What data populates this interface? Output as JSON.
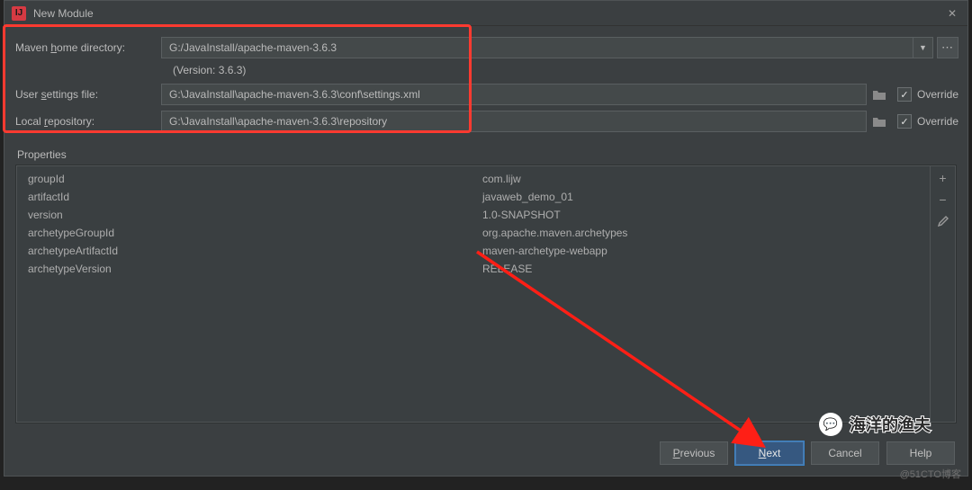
{
  "window": {
    "title": "New Module"
  },
  "form": {
    "mavenHome": {
      "label_pre": "Maven ",
      "label_u": "h",
      "label_post": "ome directory:",
      "value": "G:/JavaInstall/apache-maven-3.6.3"
    },
    "version": "(Version: 3.6.3)",
    "userSettings": {
      "label_pre": "User ",
      "label_u": "s",
      "label_post": "ettings file:",
      "value": "G:\\JavaInstall\\apache-maven-3.6.3\\conf\\settings.xml",
      "override": "Override"
    },
    "localRepo": {
      "label_pre": "Local ",
      "label_u": "r",
      "label_post": "epository:",
      "value": "G:\\JavaInstall\\apache-maven-3.6.3\\repository",
      "override": "Override"
    }
  },
  "properties": {
    "title": "Properties",
    "rows": [
      {
        "key": "groupId",
        "value": "com.lijw"
      },
      {
        "key": "artifactId",
        "value": "javaweb_demo_01"
      },
      {
        "key": "version",
        "value": "1.0-SNAPSHOT"
      },
      {
        "key": "archetypeGroupId",
        "value": "org.apache.maven.archetypes"
      },
      {
        "key": "archetypeArtifactId",
        "value": "maven-archetype-webapp"
      },
      {
        "key": "archetypeVersion",
        "value": "RELEASE"
      }
    ]
  },
  "buttons": {
    "previous": "Previous",
    "next": "Next",
    "cancel": "Cancel",
    "help": "Help"
  },
  "watermark": {
    "text": "海洋的渔夫",
    "site": "@51CTO博客"
  }
}
